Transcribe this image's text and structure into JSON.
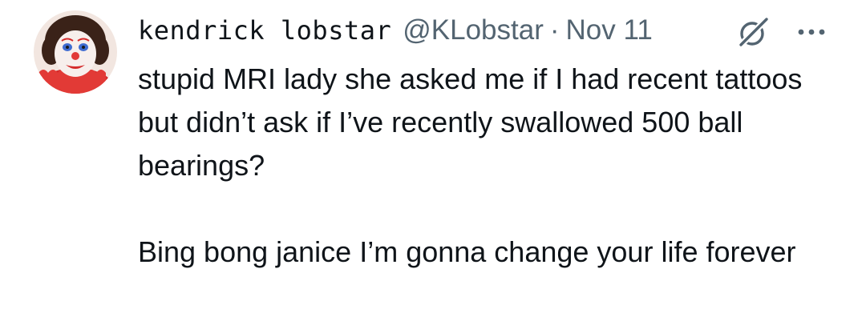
{
  "tweet": {
    "author": {
      "display_name": "kendrick lobstar",
      "handle": "@KLobstar",
      "avatar_icon": "clown-avatar"
    },
    "separator": "·",
    "date": "Nov 11",
    "grok_icon": "grok-icon",
    "more_icon": "more-icon",
    "text": "stupid MRI lady she asked me if I had recent tattoos but didn’t ask if I’ve recently swallowed 500 ball bearings?\n\nBing bong janice I’m gonna change your life forever"
  }
}
